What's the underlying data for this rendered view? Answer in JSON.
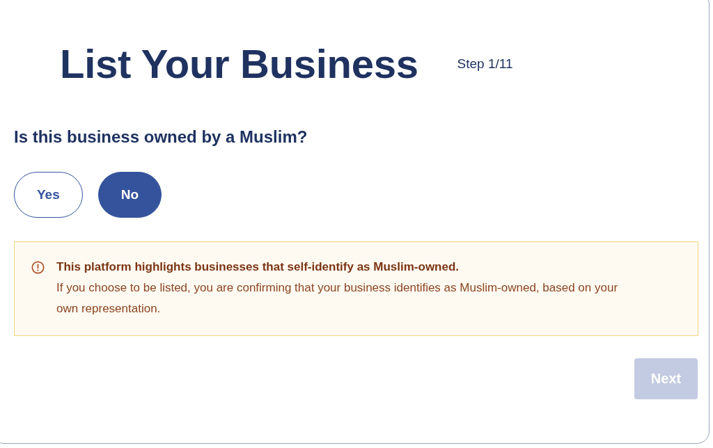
{
  "header": {
    "title": "List Your Business",
    "step": "Step 1/11"
  },
  "question": {
    "text": "Is this business owned by a Muslim?",
    "options": [
      {
        "label": "Yes",
        "selected": false
      },
      {
        "label": "No",
        "selected": true
      }
    ]
  },
  "notice": {
    "heading": "This platform highlights businesses that self-identify as Muslim-owned.",
    "body": "If you choose to be listed, you are confirming that your business identifies as Muslim-owned, based on your own representation."
  },
  "next_button": {
    "label": "Next",
    "disabled": true
  }
}
